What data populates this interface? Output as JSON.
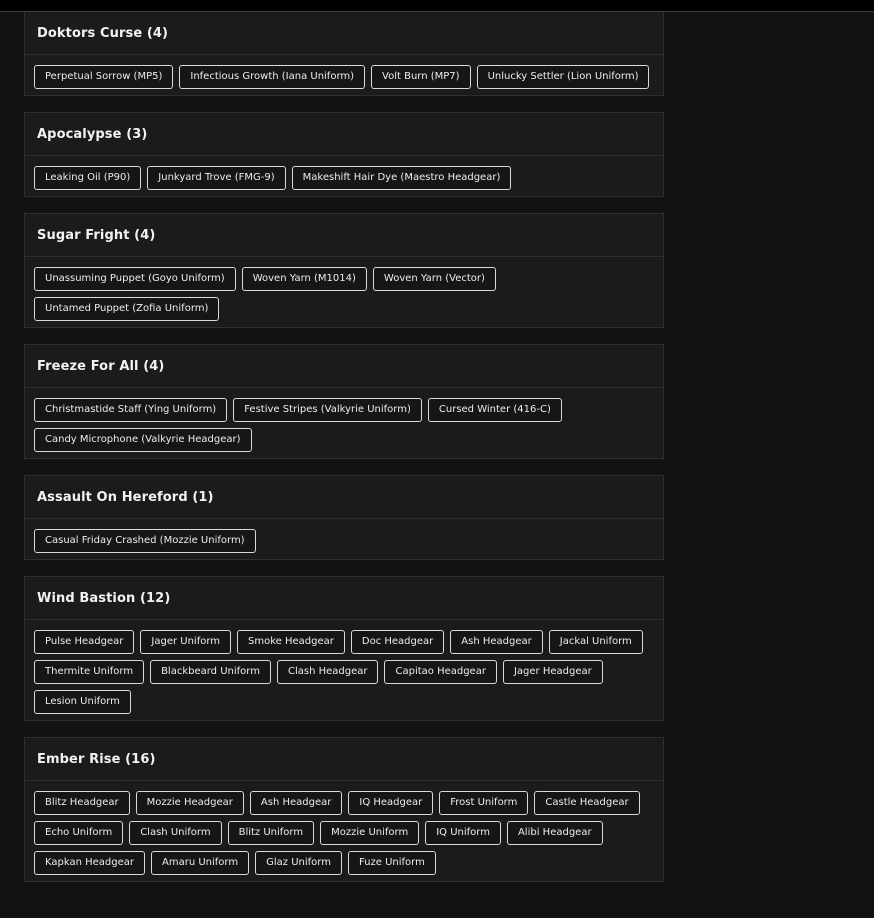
{
  "events": [
    {
      "title": "Doktors Curse (4)",
      "items": [
        "Perpetual Sorrow (MP5)",
        "Infectious Growth (Iana Uniform)",
        "Volt Burn (MP7)",
        "Unlucky Settler (Lion Uniform)"
      ]
    },
    {
      "title": "Apocalypse (3)",
      "items": [
        "Leaking Oil (P90)",
        "Junkyard Trove (FMG-9)",
        "Makeshift Hair Dye (Maestro Headgear)"
      ]
    },
    {
      "title": "Sugar Fright (4)",
      "items": [
        "Unassuming Puppet (Goyo Uniform)",
        "Woven Yarn (M1014)",
        "Woven Yarn (Vector)",
        "Untamed Puppet (Zofia Uniform)"
      ]
    },
    {
      "title": "Freeze For All (4)",
      "items": [
        "Christmastide Staff (Ying Uniform)",
        "Festive Stripes (Valkyrie Uniform)",
        "Cursed Winter (416-C)",
        "Candy Microphone (Valkyrie Headgear)"
      ]
    },
    {
      "title": "Assault On Hereford (1)",
      "items": [
        "Casual Friday Crashed (Mozzie Uniform)"
      ]
    },
    {
      "title": "Wind Bastion (12)",
      "items": [
        "Pulse Headgear",
        "Jager Uniform",
        "Smoke Headgear",
        "Doc Headgear",
        "Ash Headgear",
        "Jackal Uniform",
        "Thermite Uniform",
        "Blackbeard Uniform",
        "Clash Headgear",
        "Capitao Headgear",
        "Jager Headgear",
        "Lesion Uniform"
      ]
    },
    {
      "title": "Ember Rise (16)",
      "items": [
        "Blitz Headgear",
        "Mozzie Headgear",
        "Ash Headgear",
        "IQ Headgear",
        "Frost Uniform",
        "Castle Headgear",
        "Echo Uniform",
        "Clash Uniform",
        "Blitz Uniform",
        "Mozzie Uniform",
        "IQ Uniform",
        "Alibi Headgear",
        "Kapkan Headgear",
        "Amaru Uniform",
        "Glaz Uniform",
        "Fuze Uniform"
      ]
    }
  ]
}
